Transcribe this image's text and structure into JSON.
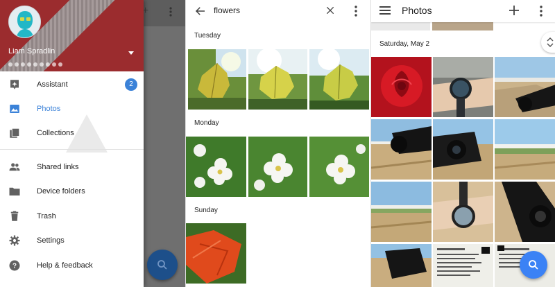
{
  "drawer": {
    "account_name": "Liam Spradlin",
    "items": [
      {
        "label": "Assistant",
        "icon": "assistant-icon",
        "badge": "2"
      },
      {
        "label": "Photos",
        "icon": "photos-icon",
        "active": true
      },
      {
        "label": "Collections",
        "icon": "collections-icon"
      },
      {
        "label": "Shared links",
        "icon": "people-icon"
      },
      {
        "label": "Device folders",
        "icon": "folder-icon"
      },
      {
        "label": "Trash",
        "icon": "trash-icon"
      },
      {
        "label": "Settings",
        "icon": "gear-icon"
      },
      {
        "label": "Help & feedback",
        "icon": "help-icon"
      }
    ]
  },
  "search": {
    "query": "flowers",
    "sections": [
      "Tuesday",
      "Monday",
      "Sunday"
    ]
  },
  "photos": {
    "title": "Photos",
    "date_header": "Saturday, May 2"
  },
  "colors": {
    "accent": "#3b82d8",
    "header_red": "#9b2c2e",
    "fab_blue": "#3b82f5"
  }
}
